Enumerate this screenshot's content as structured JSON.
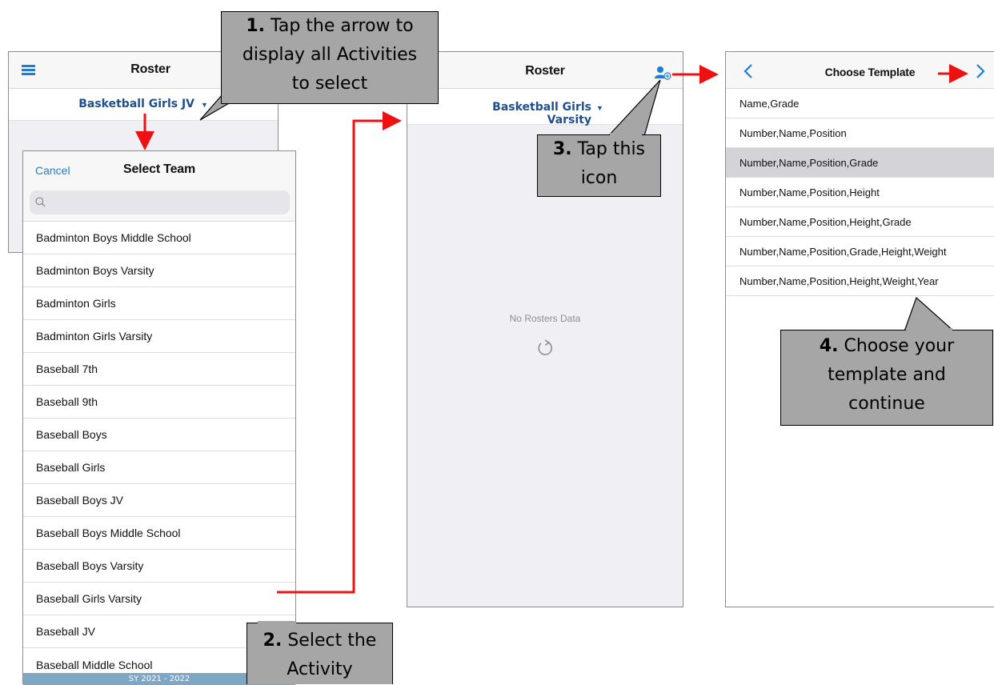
{
  "screen1": {
    "title": "Roster",
    "selected_team": "Basketball Girls JV",
    "menu_icon": "hamburger-menu-icon",
    "dropdown_icon": "caret-down-icon"
  },
  "select_team": {
    "cancel_label": "Cancel",
    "title": "Select Team",
    "search_icon": "search-icon",
    "search_placeholder": "",
    "teams": [
      "Badminton Boys Middle School",
      "Badminton Boys Varsity",
      "Badminton Girls",
      "Badminton Girls Varsity",
      "Baseball 7th",
      "Baseball 9th",
      "Baseball Boys",
      "Baseball Girls",
      "Baseball Boys JV",
      "Baseball Boys Middle School",
      "Baseball Boys Varsity",
      "Baseball Girls Varsity",
      "Baseball JV",
      "Baseball Middle School"
    ],
    "footer": "SY 2021 - 2022"
  },
  "screen2": {
    "title": "Roster",
    "selected_team": "Basketball Girls Varsity",
    "add_roster_icon": "add-person-icon",
    "empty_text": "No Rosters Data",
    "refresh_icon": "refresh-icon"
  },
  "screen3": {
    "title": "Choose Template",
    "back_icon": "chevron-left-icon",
    "forward_icon": "chevron-right-icon",
    "templates": [
      "Name,Grade",
      "Number,Name,Position",
      "Number,Name,Position,Grade",
      "Number,Name,Position,Height",
      "Number,Name,Position,Height,Grade",
      "Number,Name,Position,Grade,Height,Weight",
      "Number,Name,Position,Height,Weight,Year"
    ],
    "selected_index": 2
  },
  "callouts": {
    "c1": {
      "number": "1.",
      "line1": " Tap the arrow to",
      "line2": "display all Activities",
      "line3": "to select"
    },
    "c2": {
      "number": "2.",
      "line1": " Select the",
      "line2": "Activity"
    },
    "c3": {
      "number": "3.",
      "line1": " Tap this",
      "line2": "icon"
    },
    "c4": {
      "number": "4.",
      "line1": " Choose your",
      "line2": "template and",
      "line3": "continue"
    }
  },
  "colors": {
    "accent_blue": "#1a7fd4",
    "team_link": "#1e4f8f",
    "callout_fill": "#a6a6a6",
    "arrow_red": "#ee1111",
    "footer_bar": "#7ea7c6",
    "selected_row": "#d4d4d8"
  }
}
